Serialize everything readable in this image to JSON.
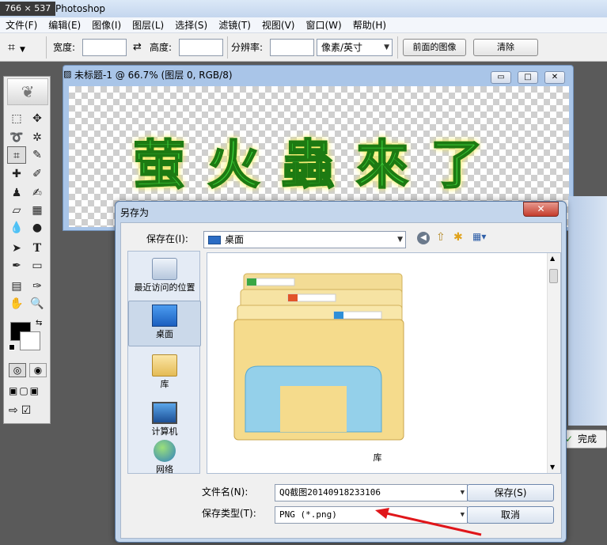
{
  "titlebar": {
    "size_badge": "766 × 537",
    "title": "Photoshop"
  },
  "menu": [
    "文件(F)",
    "编辑(E)",
    "图像(I)",
    "图层(L)",
    "选择(S)",
    "滤镜(T)",
    "视图(V)",
    "窗口(W)",
    "帮助(H)"
  ],
  "options": {
    "width_label": "宽度:",
    "height_label": "高度:",
    "resolution_label": "分辨率:",
    "unit_value": "像素/英寸",
    "front_image_btn": "前面的图像",
    "clear_btn": "清除"
  },
  "document": {
    "title": "未标题-1 @ 66.7% (图层 0, RGB/8)",
    "canvas_text": "萤火蟲來了"
  },
  "done_label": "完成",
  "dialog": {
    "title": "另存为",
    "save_in_label": "保存在(I):",
    "save_in_value": "桌面",
    "places": [
      {
        "label": "最近访问的位置",
        "icon": "recent-places-icon"
      },
      {
        "label": "桌面",
        "icon": "desktop-icon"
      },
      {
        "label": "库",
        "icon": "library-icon"
      },
      {
        "label": "计算机",
        "icon": "computer-icon"
      },
      {
        "label": "网络",
        "icon": "network-icon"
      }
    ],
    "folder_item_label": "库",
    "filename_label": "文件名(N):",
    "filename_value": "QQ截图20140918233106",
    "filetype_label": "保存类型(T):",
    "filetype_value": "PNG (*.png)",
    "save_btn": "保存(S)",
    "cancel_btn": "取消"
  },
  "colors": {
    "accent_arrow": "#e0161a",
    "dialog_frame": "#c4d6ec",
    "canvas_text": "#3fd23a"
  }
}
